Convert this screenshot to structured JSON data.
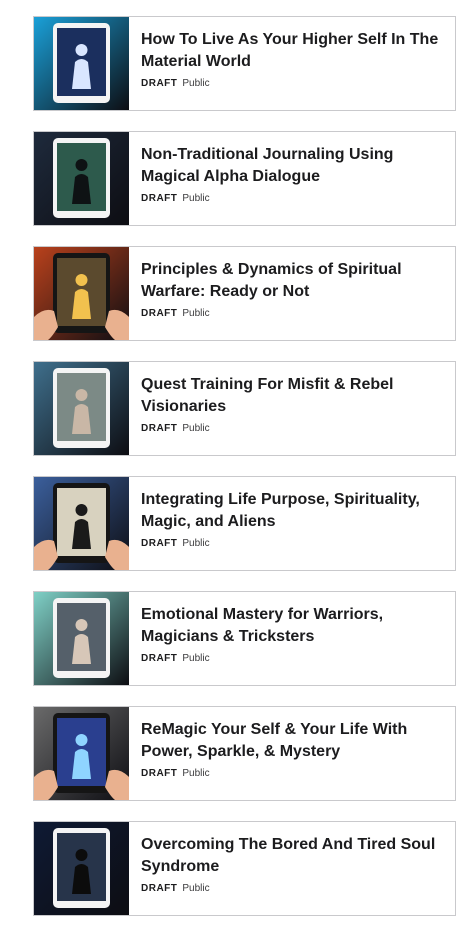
{
  "courses": [
    {
      "title": "How To Live As Your Higher Self In The Material World",
      "status": "DRAFT",
      "visibility": "Public",
      "thumbnail": {
        "bg": "#1aa0d8",
        "screen": "#1b2f5e",
        "accent": "#d9e6ff",
        "device": "#f4f4f4",
        "hands": false
      }
    },
    {
      "title": "Non-Traditional Journaling Using Magical Alpha Dialogue",
      "status": "DRAFT",
      "visibility": "Public",
      "thumbnail": {
        "bg": "#1e2a3c",
        "screen": "#2d5a4c",
        "accent": "#0e1214",
        "device": "#f4f4f4",
        "hands": false
      }
    },
    {
      "title": "Principles & Dynamics of Spiritual Warfare: Ready or Not",
      "status": "DRAFT",
      "visibility": "Public",
      "thumbnail": {
        "bg": "#b9411c",
        "screen": "#5b4a2e",
        "accent": "#f2c14e",
        "device": "#151515",
        "hands": true
      }
    },
    {
      "title": "Quest Training For Misfit & Rebel Visionaries",
      "status": "DRAFT",
      "visibility": "Public",
      "thumbnail": {
        "bg": "#3f6f8c",
        "screen": "#7c8a86",
        "accent": "#c9b7a6",
        "device": "#f4f4f4",
        "hands": false
      }
    },
    {
      "title": "Integrating Life Purpose, Spirituality, Magic, and Aliens",
      "status": "DRAFT",
      "visibility": "Public",
      "thumbnail": {
        "bg": "#3b5f9c",
        "screen": "#d8d2bf",
        "accent": "#1a1a1a",
        "device": "#151515",
        "hands": true
      }
    },
    {
      "title": "Emotional Mastery for Warriors, Magicians & Tricksters",
      "status": "DRAFT",
      "visibility": "Public",
      "thumbnail": {
        "bg": "#7fd0c6",
        "screen": "#55606a",
        "accent": "#d7c7b8",
        "device": "#f4f4f4",
        "hands": false
      }
    },
    {
      "title": "ReMagic Your Self & Your Life With Power, Sparkle, & Mystery",
      "status": "DRAFT",
      "visibility": "Public",
      "thumbnail": {
        "bg": "#6a6a6a",
        "screen": "#2a3f8f",
        "accent": "#8fd4ff",
        "device": "#151515",
        "hands": true
      }
    },
    {
      "title": "Overcoming The Bored And Tired Soul Syndrome",
      "status": "DRAFT",
      "visibility": "Public",
      "thumbnail": {
        "bg": "#0e1a34",
        "screen": "#27344a",
        "accent": "#0c0c0c",
        "device": "#f4f4f4",
        "hands": false
      }
    }
  ]
}
